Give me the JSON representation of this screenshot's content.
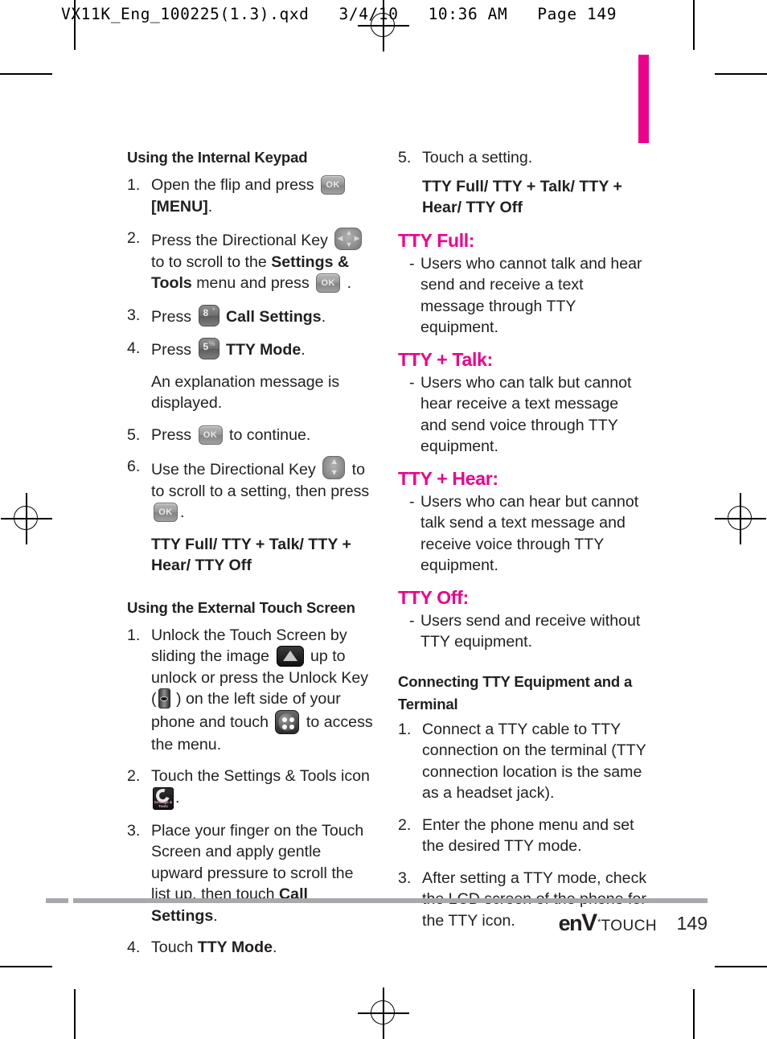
{
  "header": {
    "text": "VX11K_Eng_100225(1.3).qxd   3/4/10   10:36 AM   Page 149"
  },
  "colors": {
    "accent": "#EC008C",
    "text": "#231F20",
    "rule": "#A7A9AC"
  },
  "left_column": {
    "section1_title": "Using the Internal Keypad",
    "steps": [
      {
        "num": "1.",
        "a": "Open the flip and press",
        "icon": "ok-key",
        "b": "[MENU].",
        "b_bold": "[MENU]"
      },
      {
        "num": "2.",
        "a": "Press the Directional Key",
        "icon": "directional-key",
        "b": "to scroll to the Settings & Tools menu and press",
        "icon2": "ok-key",
        "c": "."
      },
      {
        "num": "3.",
        "a": "Press",
        "icon": "key-8",
        "b": "Call Settings."
      },
      {
        "num": "4.",
        "a": "Press",
        "icon": "key-5",
        "b": "TTY Mode."
      },
      {
        "num": "5.",
        "a": "Press",
        "icon": "ok-key",
        "b": "to continue."
      },
      {
        "num": "6.",
        "a": "Use the Directional Key",
        "icon": "up-down-key",
        "b": "to scroll to a setting, then press",
        "icon2": "ok-key",
        "c": "."
      }
    ],
    "step4_note": "An explanation message is displayed.",
    "step2_text_pre": "Press the Directional Key",
    "step2_text_mid": "to scroll to the ",
    "step2_bold": "Settings & Tools",
    "step2_text_post": " menu and press",
    "step3_pre": "Press",
    "step3_bold": "Call Settings",
    "step3_post": ".",
    "step4_pre": "Press",
    "step4_bold": "TTY Mode",
    "step4_post": ".",
    "step5_pre": "Press",
    "step5_post": "to continue.",
    "step6_pre": "Use the Directional Key",
    "step6_mid": "to scroll to a setting, then press",
    "step6_post": ".",
    "step1_pre": "Open the flip and press",
    "step1_bold": "[MENU]",
    "step1_post": ".",
    "settings_list": "TTY Full/ TTY + Talk/ TTY + Hear/ TTY Off",
    "section2_title": "Using the External Touch Screen",
    "ext_step1_a": "Unlock the Touch Screen by sliding the image",
    "ext_step1_b": "up to unlock or press the Unlock Key (",
    "ext_step1_c": ") on the left side of your phone and touch",
    "ext_step1_d": "to access the menu.",
    "ext_step2_a": "Touch the Settings & Tools icon",
    "ext_step2_b": ".",
    "ext_step3_a": "Place your finger on the Touch Screen and apply gentle upward pressure to scroll the list up, then touch ",
    "ext_step3_bold": "Call Settings",
    "ext_step3_b": ".",
    "ext_step4_a": "Touch ",
    "ext_step4_bold": "TTY Mode",
    "ext_step4_b": ".",
    "nums": {
      "n1": "1.",
      "n2": "2.",
      "n3": "3.",
      "n4": "4.",
      "n5": "5.",
      "n6": "6."
    }
  },
  "right_column": {
    "step5_num": "5.",
    "step5_text": "Touch a setting.",
    "settings_list": "TTY Full/ TTY + Talk/ TTY + Hear/ TTY Off",
    "modes": [
      {
        "heading": "TTY Full:",
        "dash": "-",
        "desc": "Users who cannot  talk and hear send and receive a text message through TTY equipment."
      },
      {
        "heading": "TTY + Talk:",
        "dash": "-",
        "desc": "Users who can talk but cannot hear receive a text message and send voice through TTY equipment."
      },
      {
        "heading": "TTY + Hear:",
        "dash": "-",
        "desc": "Users who can hear but cannot talk send a text message and receive voice through TTY equipment."
      },
      {
        "heading": "TTY Off:",
        "dash": "-",
        "desc": "Users send and receive without TTY equipment."
      }
    ],
    "connect_title": "Connecting TTY Equipment and a Terminal",
    "connect_steps": [
      {
        "num": "1.",
        "text": "Connect a TTY cable to TTY connection on the terminal (TTY connection location is the same as a headset jack)."
      },
      {
        "num": "2.",
        "text": "Enter the phone menu and set the desired TTY mode."
      },
      {
        "num": "3.",
        "text": "After setting a TTY mode, check the LCD screen of the phone for the TTY icon."
      }
    ]
  },
  "footer": {
    "brand_en": "en",
    "brand_v": "V",
    "brand_star": "*",
    "brand_touch": "TOUCH",
    "page_number": "149"
  },
  "keys": {
    "ok_label": "OK",
    "key8_digit": "8",
    "key8_sym": "*",
    "key5_digit": "5",
    "key5_sym": "%",
    "settings_icon_label": "Settings & Tools"
  }
}
